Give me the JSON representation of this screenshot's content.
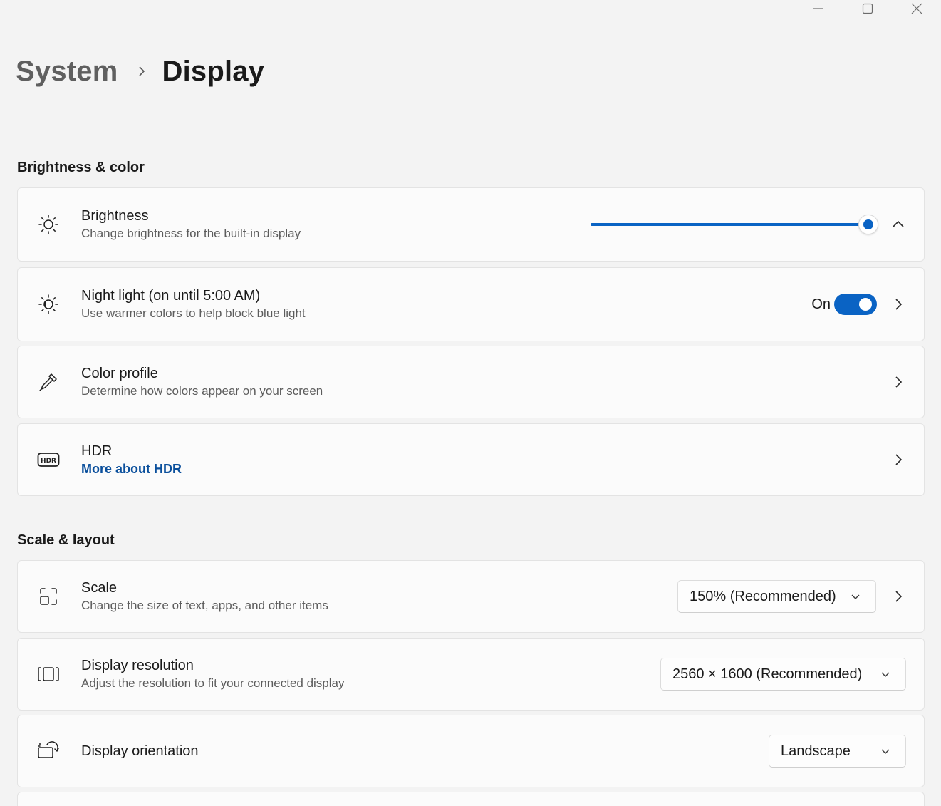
{
  "window": {
    "controls": [
      {
        "name": "minimize",
        "icon": "minimize-icon"
      },
      {
        "name": "maximize",
        "icon": "maximize-icon"
      },
      {
        "name": "close",
        "icon": "close-icon"
      }
    ]
  },
  "breadcrumb": {
    "parent": "System",
    "current": "Display"
  },
  "sections": {
    "brightness_color": {
      "title": "Brightness & color",
      "brightness": {
        "title": "Brightness",
        "subtitle": "Change brightness for the built-in display",
        "level_percent": 100,
        "icon": "sun-icon",
        "expander_icon": "chevron-up-icon"
      },
      "night_light": {
        "title": "Night light (on until 5:00 AM)",
        "subtitle": "Use warmer colors to help block blue light",
        "toggle_label": "On",
        "toggle_state": true,
        "icon": "night-light-icon"
      },
      "color_profile": {
        "title": "Color profile",
        "subtitle": "Determine how colors appear on your screen",
        "icon": "eyedropper-icon"
      },
      "hdr": {
        "title": "HDR",
        "link": "More about HDR",
        "icon": "hdr-icon",
        "icon_text": "HDR"
      }
    },
    "scale_layout": {
      "title": "Scale & layout",
      "scale": {
        "title": "Scale",
        "subtitle": "Change the size of text, apps, and other items",
        "value": "150% (Recommended)",
        "icon": "scale-icon"
      },
      "resolution": {
        "title": "Display resolution",
        "subtitle": "Adjust the resolution to fit your connected display",
        "value": "2560 × 1600 (Recommended)",
        "icon": "resolution-icon"
      },
      "orientation": {
        "title": "Display orientation",
        "value": "Landscape",
        "icon": "orientation-icon"
      }
    }
  },
  "colors": {
    "accent": "#0a63c4",
    "link": "#0a4f9c",
    "background": "#f3f3f3",
    "card": "#fbfbfb"
  }
}
